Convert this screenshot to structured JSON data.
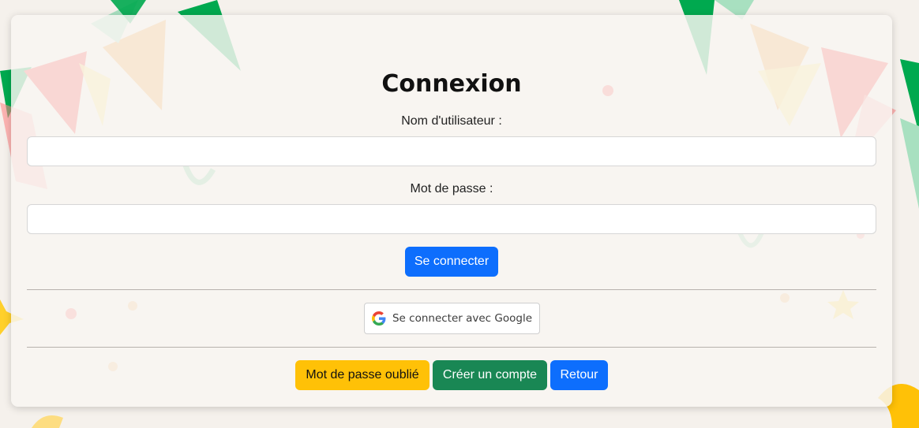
{
  "login": {
    "title": "Connexion",
    "username_label": "Nom d'utilisateur :",
    "username_value": "",
    "password_label": "Mot de passe :",
    "password_value": "",
    "submit_label": "Se connecter",
    "google_label": "Se connecter avec Google",
    "forgot_label": "Mot de passe oublié",
    "create_label": "Créer un compte",
    "back_label": "Retour"
  },
  "colors": {
    "primary": "#0d6efd",
    "warning": "#ffc107",
    "success": "#198754",
    "background": "#f5f1ec"
  },
  "decor": {
    "bunting_colors": [
      "#00a94f",
      "#ff3b3b",
      "#f5a142",
      "#ffe066",
      "#a8e0c0"
    ],
    "icons": [
      "bunting-flags",
      "confetti",
      "star-icon"
    ]
  }
}
